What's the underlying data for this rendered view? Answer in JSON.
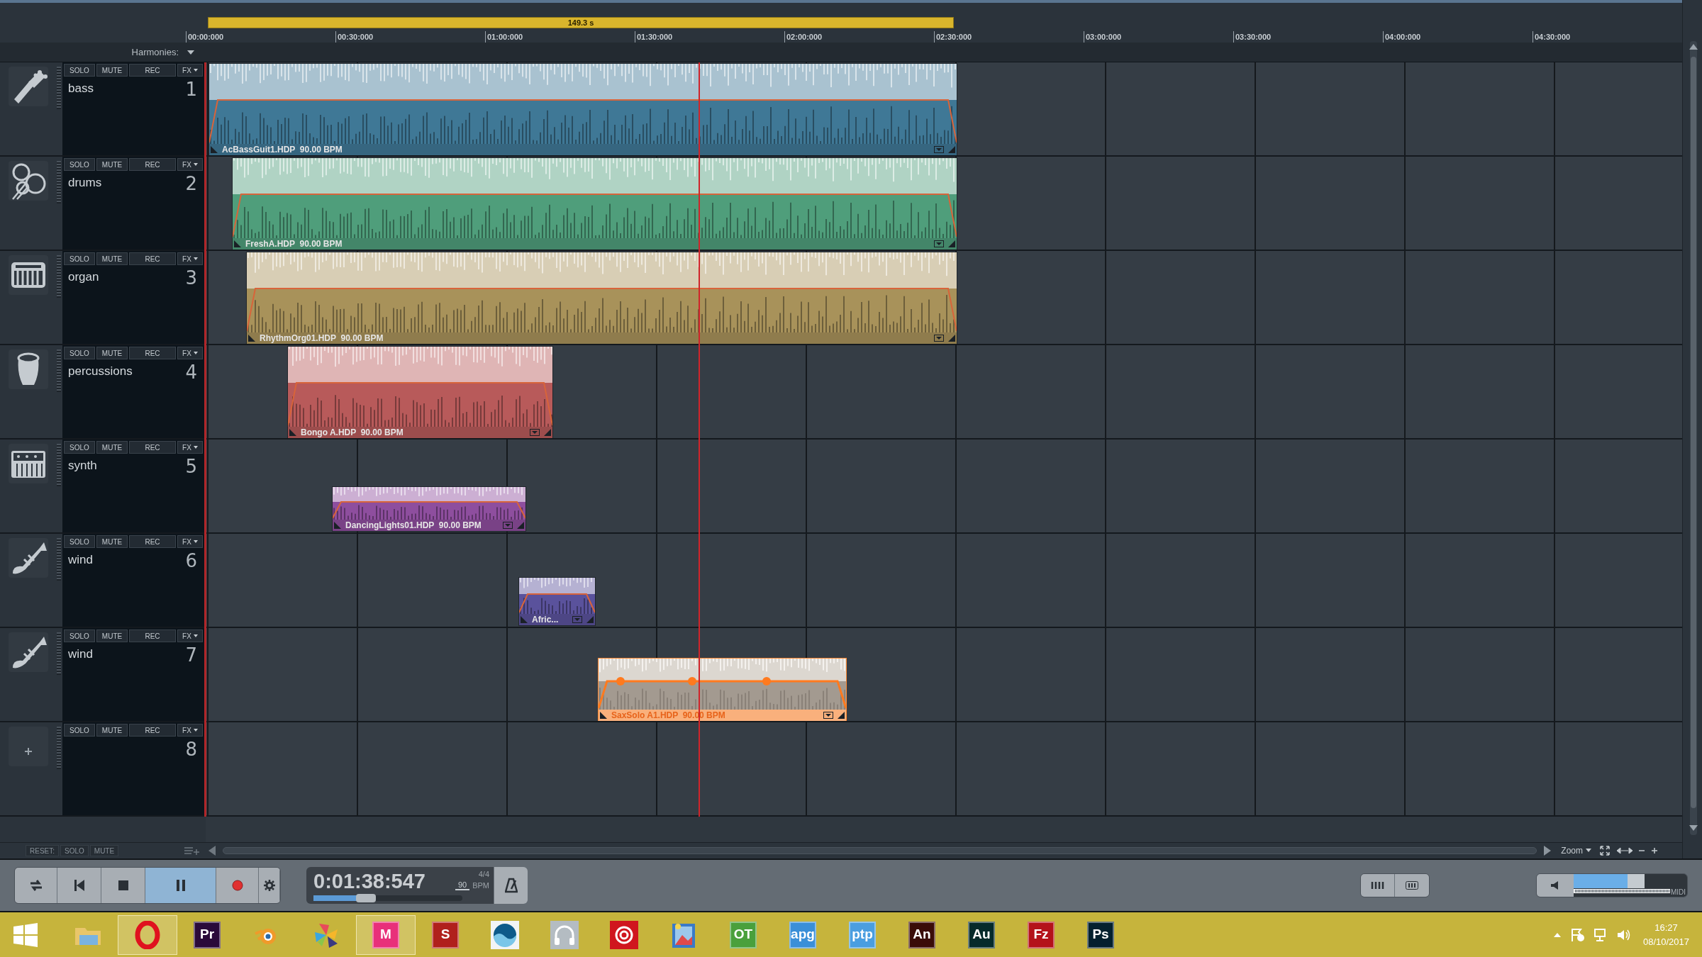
{
  "loop_bar": {
    "label": "149.3 s"
  },
  "ruler": [
    "00:00:000",
    "00:30:000",
    "01:00:000",
    "01:30:000",
    "02:00:000",
    "02:30:000",
    "03:00:000",
    "03:30:000",
    "04:00:000",
    "04:30:000"
  ],
  "harmonies": {
    "label": "Harmonies:"
  },
  "tracks": [
    {
      "kind": "guitar",
      "name": "bass",
      "number": "1",
      "buttons": [
        "SOLO",
        "MUTE",
        "REC",
        "FX"
      ],
      "clip": {
        "label": "AcBassGuit1.HDP  90.00 BPM",
        "color": "#3f7896",
        "selected": false
      }
    },
    {
      "kind": "drums",
      "name": "drums",
      "number": "2",
      "buttons": [
        "SOLO",
        "MUTE",
        "REC",
        "FX"
      ],
      "clip": {
        "label": "FreshA.HDP  90.00 BPM",
        "color": "#4f9e7b",
        "selected": false
      }
    },
    {
      "kind": "organ",
      "name": "organ",
      "number": "3",
      "buttons": [
        "SOLO",
        "MUTE",
        "REC",
        "FX"
      ],
      "clip": {
        "label": "RhythmOrg01.HDP  90.00 BPM",
        "color": "#a8925a",
        "selected": false
      }
    },
    {
      "kind": "conga",
      "name": "percussions",
      "number": "4",
      "buttons": [
        "SOLO",
        "MUTE",
        "REC",
        "FX"
      ],
      "clip": {
        "label": "Bongo A.HDP  90.00 BPM",
        "color": "#b85a5a",
        "selected": false
      }
    },
    {
      "kind": "synth",
      "name": "synth",
      "number": "5",
      "buttons": [
        "SOLO",
        "MUTE",
        "REC",
        "FX"
      ],
      "clip": {
        "label": "DancingLights01.HDP  90.00 BPM",
        "color": "#8e4e9e",
        "selected": false
      }
    },
    {
      "kind": "trumpet",
      "name": "wind",
      "number": "6",
      "buttons": [
        "SOLO",
        "MUTE",
        "REC",
        "FX"
      ],
      "clip": {
        "label": "Afric...",
        "color": "#5a529c",
        "selected": false
      }
    },
    {
      "kind": "trumpet",
      "name": "wind",
      "number": "7",
      "buttons": [
        "SOLO",
        "MUTE",
        "REC",
        "FX"
      ],
      "clip": {
        "label": "SaxSolo A1.HDP  90.00 BPM",
        "color": "#a39a90",
        "selected": true
      }
    },
    {
      "kind": "add",
      "number": "8",
      "buttons": [
        "SOLO",
        "MUTE",
        "REC",
        "FX"
      ]
    }
  ],
  "footer": {
    "buttons": [
      "RESET:",
      "SOLO",
      "MUTE"
    ],
    "zoom": "Zoom"
  },
  "transport": {
    "buttons": [
      {
        "kind": "loop",
        "selected": false
      },
      {
        "kind": "rewind",
        "selected": false
      },
      {
        "kind": "stop",
        "selected": false
      },
      {
        "kind": "pause",
        "selected": true
      },
      {
        "kind": "record",
        "selected": false
      },
      {
        "kind": "settings",
        "selected": false
      }
    ],
    "time": "0:01:38:547",
    "signature": "4/4",
    "tempo": "90",
    "tempo_unit": "BPM",
    "position": {
      "level": 0.35
    },
    "volume": {
      "level": 0.55
    },
    "midi": "MIDI"
  },
  "taskbar": {
    "apps": [
      {
        "kind": "folder",
        "active": false
      },
      {
        "kind": "ring",
        "color": "#e0121e",
        "active": true
      },
      {
        "kind": "text",
        "label": "Pr",
        "color": "#2a0a3a",
        "active": false
      },
      {
        "kind": "blender",
        "active": false
      },
      {
        "kind": "pinwheel",
        "active": false
      },
      {
        "kind": "text",
        "label": "M",
        "color": "#e8307a",
        "active": true
      },
      {
        "kind": "text",
        "label": "S",
        "color": "#b0201c",
        "active": false
      },
      {
        "kind": "wave",
        "active": false
      },
      {
        "kind": "headphones",
        "active": false
      },
      {
        "kind": "cloud",
        "color": "#d0161e",
        "active": false
      },
      {
        "kind": "photo",
        "active": false
      },
      {
        "kind": "text",
        "label": "OT",
        "color": "#4aa03c",
        "active": false
      },
      {
        "kind": "text",
        "label": "apg",
        "color": "#3a8fd8",
        "active": false
      },
      {
        "kind": "text",
        "label": "ptp",
        "color": "#4a9ee0",
        "active": false
      },
      {
        "kind": "text",
        "label": "An",
        "color": "#3a0c08",
        "active": false
      },
      {
        "kind": "text",
        "label": "Au",
        "color": "#062a2a",
        "active": false
      },
      {
        "kind": "text",
        "label": "Fz",
        "color": "#b4121a",
        "active": false
      },
      {
        "kind": "text",
        "label": "Ps",
        "color": "#04202e",
        "active": false
      }
    ],
    "time": "16:27",
    "date": "08/10/2017"
  }
}
